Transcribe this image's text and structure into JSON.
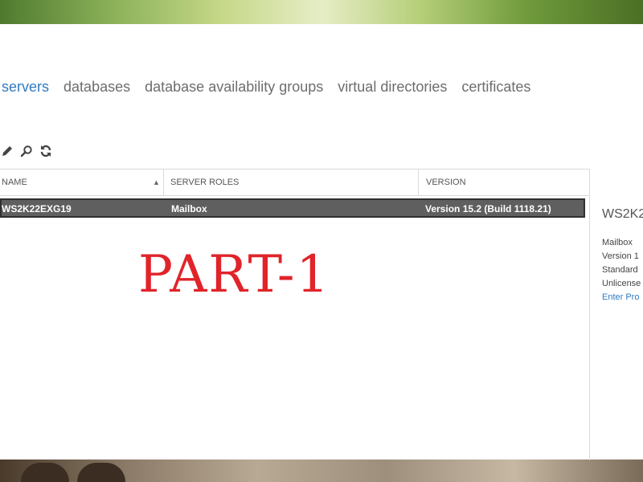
{
  "tabs": [
    {
      "label": "servers",
      "active": true
    },
    {
      "label": "databases",
      "active": false
    },
    {
      "label": "database availability groups",
      "active": false
    },
    {
      "label": "virtual directories",
      "active": false
    },
    {
      "label": "certificates",
      "active": false
    }
  ],
  "toolbar": {
    "icons": [
      "edit-icon",
      "search-icon",
      "refresh-icon"
    ]
  },
  "grid": {
    "columns": [
      "NAME",
      "SERVER ROLES",
      "VERSION"
    ],
    "sort": {
      "column": "NAME",
      "direction": "ascending"
    },
    "rows": [
      {
        "name": "WS2K22EXG19",
        "roles": "Mailbox",
        "version": "Version 15.2 (Build 1118.21)"
      }
    ]
  },
  "details": {
    "title": "WS2K2",
    "lines": [
      "Mailbox",
      "Version 1",
      "Standard",
      "Unlicense"
    ],
    "link": "Enter Pro"
  },
  "overlay": {
    "text": "PART-1",
    "color": "#e0242a"
  },
  "colors": {
    "accent": "#2f7bc0",
    "selected_row": "#5f5f5f"
  }
}
